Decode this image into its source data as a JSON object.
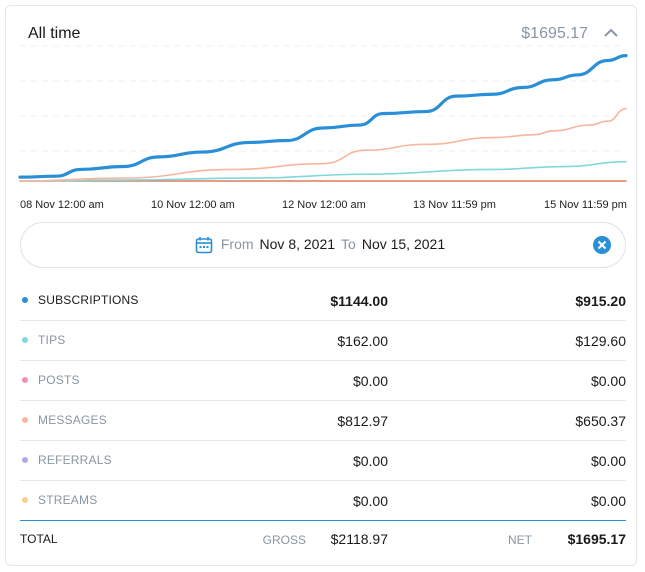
{
  "header": {
    "title": "All time",
    "total": "$1695.17",
    "toggle_icon": "chevron-up-icon"
  },
  "chart_data": {
    "type": "line",
    "x": [
      "08 Nov 12:00 am",
      "10 Nov 12:00 am",
      "12 Nov 12:00 am",
      "13 Nov 11:59 pm",
      "15 Nov 11:59 pm"
    ],
    "series": [
      {
        "color": "#2a8fd6",
        "points": [
          [
            0,
            4
          ],
          [
            6,
            5
          ],
          [
            10,
            12
          ],
          [
            17,
            15
          ],
          [
            23,
            25
          ],
          [
            30,
            30
          ],
          [
            38,
            40
          ],
          [
            44,
            42
          ],
          [
            50,
            55
          ],
          [
            56,
            58
          ],
          [
            60,
            70
          ],
          [
            67,
            72
          ],
          [
            72,
            88
          ],
          [
            78,
            90
          ],
          [
            83,
            97
          ],
          [
            88,
            105
          ],
          [
            92,
            110
          ],
          [
            97,
            125
          ],
          [
            100,
            130
          ]
        ]
      },
      {
        "color": "#f7b69e",
        "points": [
          [
            0,
            0
          ],
          [
            17,
            3
          ],
          [
            35,
            12
          ],
          [
            50,
            18
          ],
          [
            57,
            32
          ],
          [
            67,
            38
          ],
          [
            78,
            45
          ],
          [
            85,
            48
          ],
          [
            88,
            52
          ],
          [
            94,
            58
          ],
          [
            97,
            62
          ],
          [
            100,
            75
          ]
        ]
      },
      {
        "color": "#7fd8dc",
        "points": [
          [
            0,
            0
          ],
          [
            17,
            1
          ],
          [
            38,
            3
          ],
          [
            57,
            7
          ],
          [
            78,
            12
          ],
          [
            90,
            15
          ],
          [
            100,
            20
          ]
        ]
      },
      {
        "color": "#e07b5a",
        "points": [
          [
            0,
            0
          ],
          [
            100,
            0
          ]
        ]
      }
    ],
    "ylim": [
      0,
      140
    ]
  },
  "range": {
    "from_label": "From",
    "from_date": "Nov 8, 2021",
    "to_label": "To",
    "to_date": "Nov 15, 2021"
  },
  "rows": [
    {
      "label": "SUBSCRIPTIONS",
      "gross": "$1144.00",
      "net": "$915.20",
      "color": "#2a8fd6",
      "active": true
    },
    {
      "label": "TIPS",
      "gross": "$162.00",
      "net": "$129.60",
      "color": "#7fd8dc",
      "active": false
    },
    {
      "label": "POSTS",
      "gross": "$0.00",
      "net": "$0.00",
      "color": "#f08fb0",
      "active": false
    },
    {
      "label": "MESSAGES",
      "gross": "$812.97",
      "net": "$650.37",
      "color": "#f7b69e",
      "active": false
    },
    {
      "label": "REFERRALS",
      "gross": "$0.00",
      "net": "$0.00",
      "color": "#b7a6e8",
      "active": false
    },
    {
      "label": "STREAMS",
      "gross": "$0.00",
      "net": "$0.00",
      "color": "#f7d08a",
      "active": false
    }
  ],
  "total": {
    "label": "TOTAL",
    "gross_label": "GROSS",
    "gross": "$2118.97",
    "net_label": "NET",
    "net": "$1695.17"
  }
}
